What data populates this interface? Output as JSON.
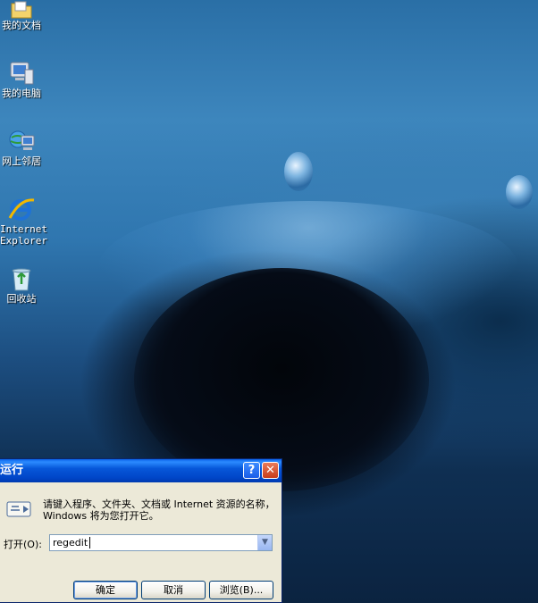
{
  "desktop": {
    "icons": [
      {
        "label": "我的文档",
        "icon": "my-documents-icon"
      },
      {
        "label": "我的电脑",
        "icon": "my-computer-icon"
      },
      {
        "label": "网上邻居",
        "icon": "network-places-icon"
      },
      {
        "label": "Internet\nExplorer",
        "icon": "internet-explorer-icon"
      },
      {
        "label": "回收站",
        "icon": "recycle-bin-icon"
      }
    ]
  },
  "run_dialog": {
    "title": "运行",
    "help_button": "?",
    "close_button": "✕",
    "description": "请键入程序、文件夹、文档或 Internet 资源的名称，Windows 将为您打开它。",
    "open_label": "打开(O):",
    "open_value": "regedit",
    "ok_label": "确定",
    "cancel_label": "取消",
    "browse_label": "浏览(B)..."
  },
  "colors": {
    "titlebar": "#0757d9",
    "dialog_bg": "#ece9d8",
    "close_red": "#c93c1a"
  }
}
